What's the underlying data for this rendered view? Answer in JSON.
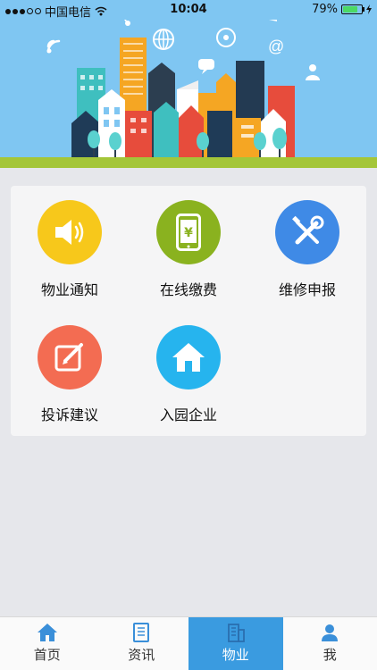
{
  "status_bar": {
    "carrier": "中国电信",
    "time": "10:04",
    "battery": "79%",
    "battery_level": 0.79
  },
  "services": [
    {
      "label": "物业通知",
      "icon": "speaker-icon",
      "color": "#f7c81b"
    },
    {
      "label": "在线缴费",
      "icon": "phone-payment-icon",
      "color": "#8ab21f"
    },
    {
      "label": "维修申报",
      "icon": "tools-icon",
      "color": "#3f8ae6"
    },
    {
      "label": "投诉建议",
      "icon": "edit-icon",
      "color": "#f36c52"
    },
    {
      "label": "入园企业",
      "icon": "home-icon",
      "color": "#26b4ee"
    }
  ],
  "tabs": [
    {
      "label": "首页",
      "icon": "home-icon",
      "active": false
    },
    {
      "label": "资讯",
      "icon": "book-icon",
      "active": false
    },
    {
      "label": "物业",
      "icon": "building-icon",
      "active": true
    },
    {
      "label": "我",
      "icon": "user-icon",
      "active": false
    }
  ],
  "colors": {
    "banner_sky": "#7fc6f2",
    "tab_active": "#3a9be0",
    "page_bg": "#e6e7eb"
  }
}
